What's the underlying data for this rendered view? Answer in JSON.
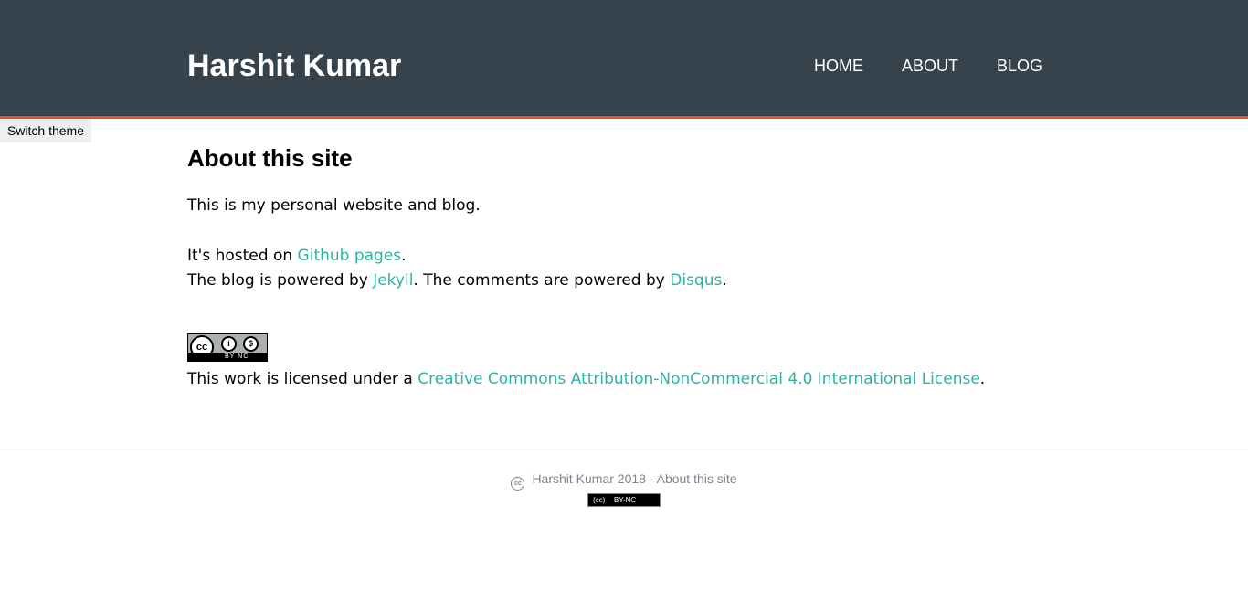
{
  "header": {
    "site_title": "Harshit Kumar",
    "nav": [
      "HOME",
      "ABOUT",
      "BLOG"
    ]
  },
  "switch_theme_label": "Switch theme",
  "main": {
    "heading": "About this site",
    "intro": "This is my personal website and blog.",
    "hosted_prefix": "It's hosted on ",
    "hosted_link": "Github pages",
    "hosted_suffix": ".",
    "blog_prefix": "The blog is powered by ",
    "blog_link": "Jekyll",
    "comments_prefix": ". The comments are powered by ",
    "comments_link": "Disqus",
    "comments_suffix": ".",
    "license_badge_text": "BY NC",
    "license_prefix": "This work is licensed under a ",
    "license_link": "Creative Commons Attribution-NonCommercial 4.0 International License",
    "license_suffix": "."
  },
  "footer": {
    "text": "Harshit Kumar 2018 - About this site",
    "badge_cc": "(cc)",
    "badge_label": "BY-NC"
  },
  "colors": {
    "header_bg": "#36424c",
    "header_accent": "#e0542f",
    "link": "#2bb3a1",
    "footer_text": "#7a8591"
  }
}
